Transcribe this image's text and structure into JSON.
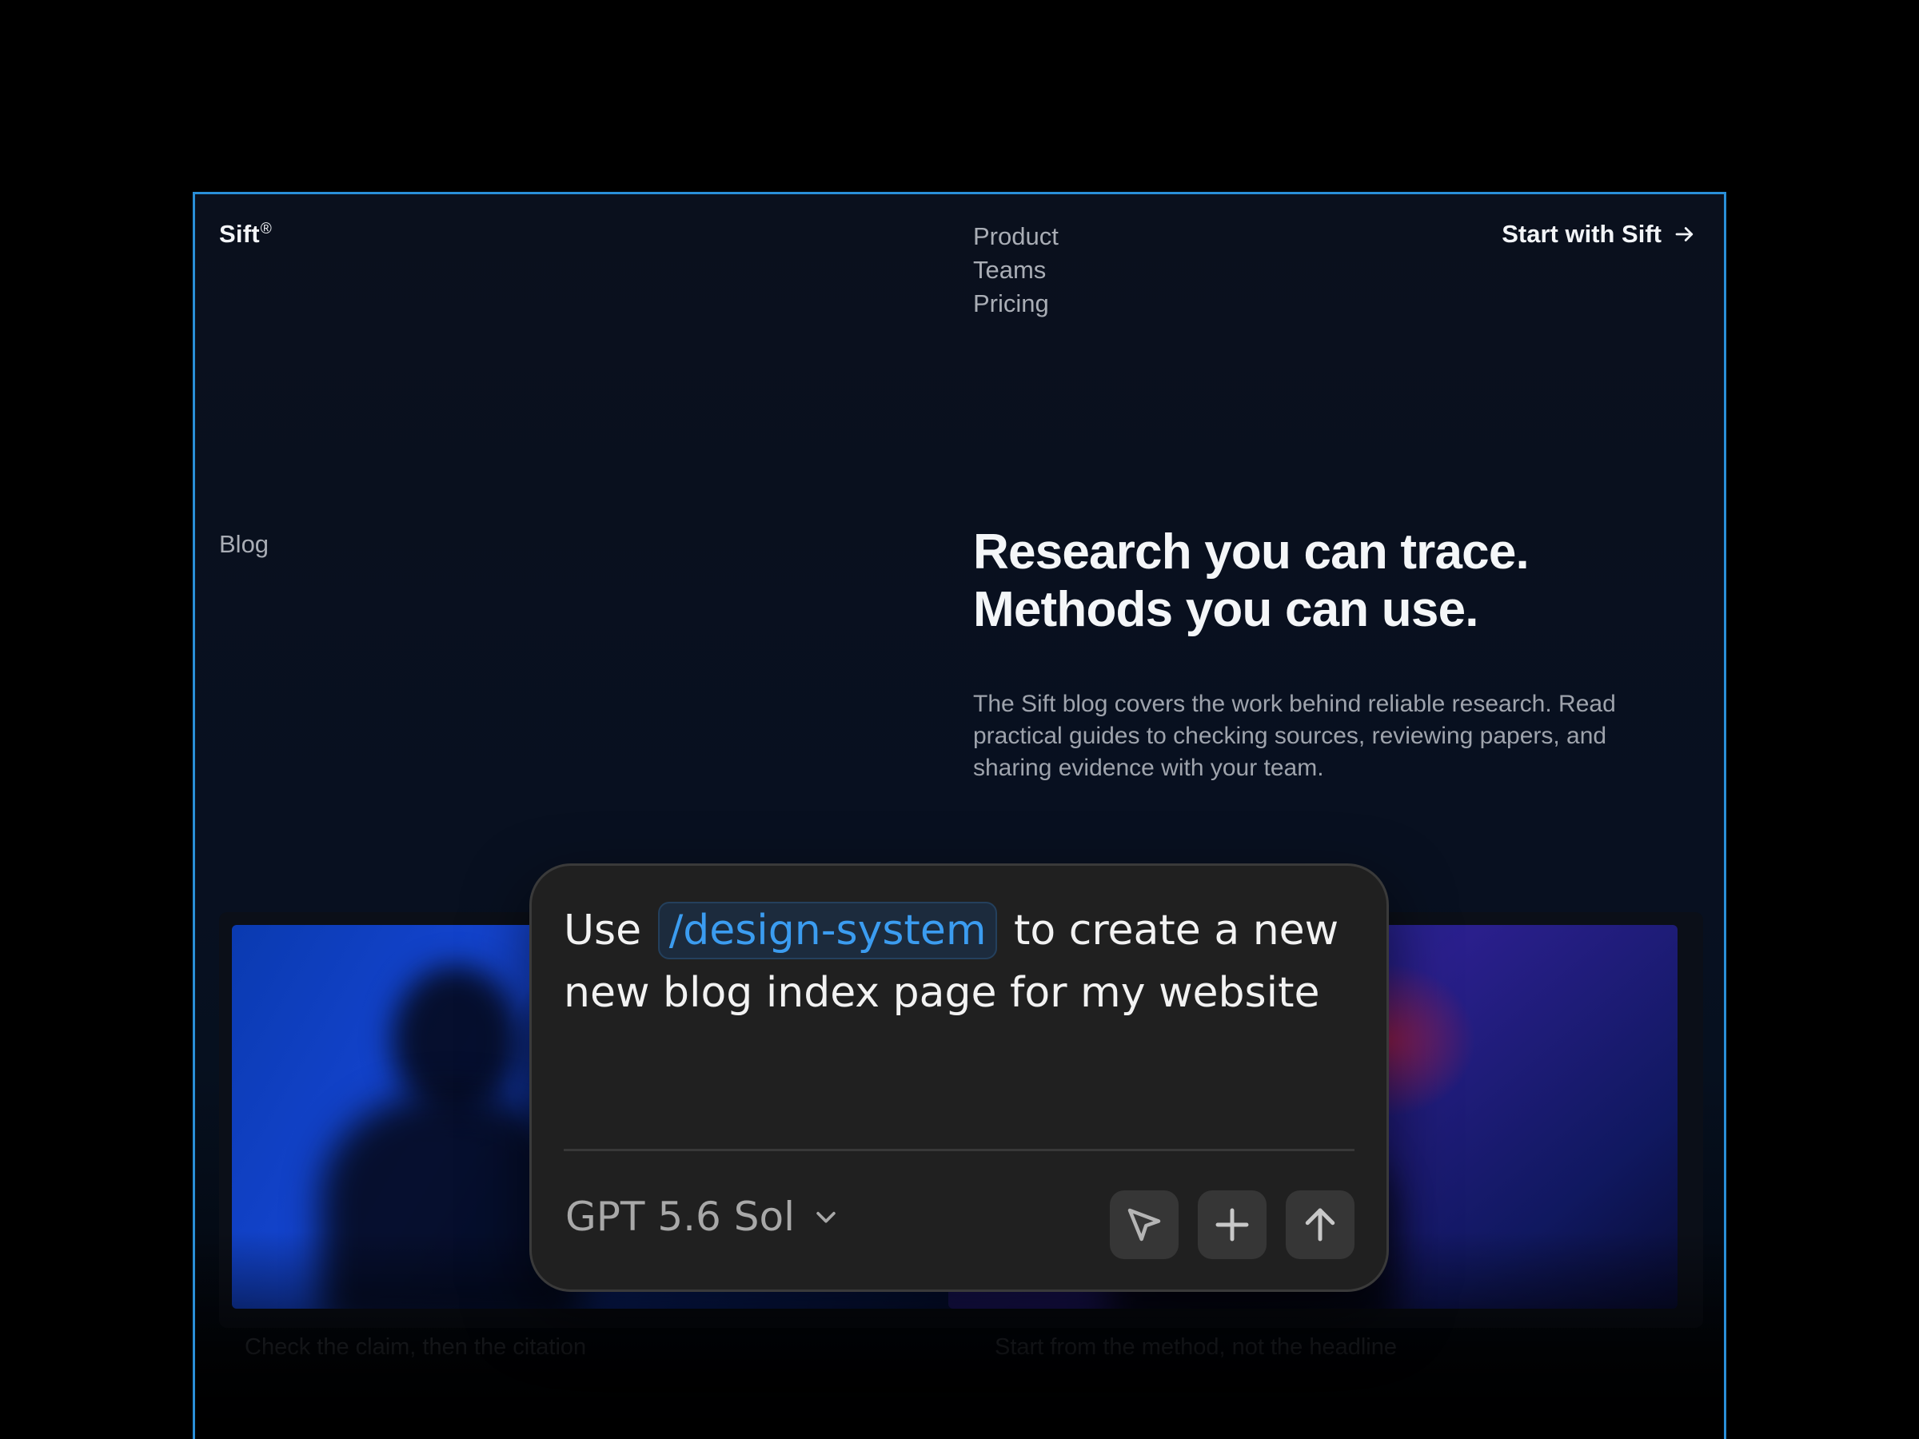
{
  "site": {
    "brand": "Sift",
    "brand_mark": "®",
    "nav": [
      {
        "label": "Product"
      },
      {
        "label": "Teams"
      },
      {
        "label": "Pricing"
      }
    ],
    "cta_label": "Start with Sift",
    "cta_icon": "arrow-right-icon",
    "section_label": "Blog",
    "hero_title_lines": [
      "Research you can trace.",
      "Methods you can use."
    ],
    "hero_description": "The Sift blog covers the work behind reliable research. Read practical guides to checking sources, reviewing papers, and sharing evidence with your team.",
    "cards": [
      {
        "title": "Check the claim, then the citation"
      },
      {
        "title": "Start from the method, not the headline"
      }
    ]
  },
  "composer": {
    "prompt_before": "Use",
    "mention": "/design-system",
    "prompt_after": "to create a new new blog index page for my website",
    "model_label": "GPT 5.6 Sol",
    "model_icon": "chevron-down-icon",
    "actions": [
      {
        "icon": "cursor-icon"
      },
      {
        "icon": "plus-icon"
      },
      {
        "icon": "arrow-up-icon"
      }
    ]
  },
  "colors": {
    "frame_border": "#2a8fd8",
    "mention_text": "#3b9cf0",
    "composer_bg": "#202020",
    "page_bg": "#000000"
  }
}
